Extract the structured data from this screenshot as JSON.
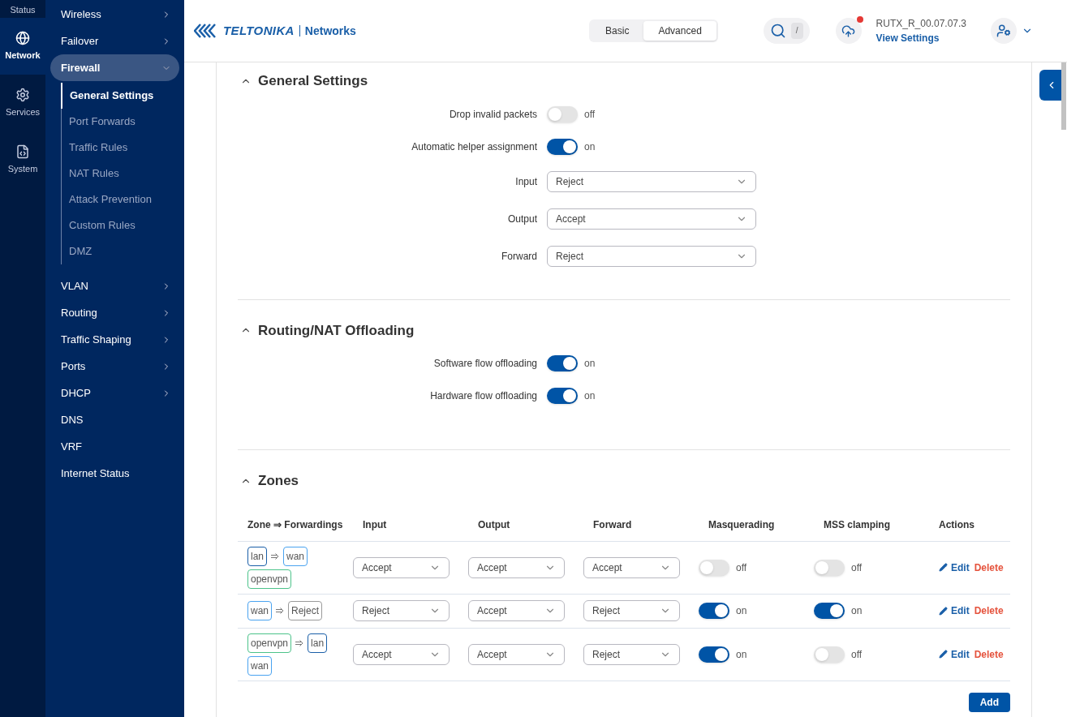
{
  "rail": [
    {
      "label": "Status",
      "selected": false
    },
    {
      "label": "Network",
      "selected": true
    },
    {
      "label": "Services",
      "selected": false
    },
    {
      "label": "System",
      "selected": false
    }
  ],
  "menu": [
    {
      "label": "Wireless",
      "arrow": true,
      "expanded": false
    },
    {
      "label": "Failover",
      "arrow": true,
      "expanded": false
    },
    {
      "label": "Firewall",
      "arrow": true,
      "expanded": true,
      "children": [
        {
          "label": "General Settings",
          "selected": true
        },
        {
          "label": "Port Forwards",
          "selected": false
        },
        {
          "label": "Traffic Rules",
          "selected": false
        },
        {
          "label": "NAT Rules",
          "selected": false
        },
        {
          "label": "Attack Prevention",
          "selected": false
        },
        {
          "label": "Custom Rules",
          "selected": false
        },
        {
          "label": "DMZ",
          "selected": false
        }
      ]
    },
    {
      "label": "VLAN",
      "arrow": true,
      "expanded": false
    },
    {
      "label": "Routing",
      "arrow": true,
      "expanded": false
    },
    {
      "label": "Traffic Shaping",
      "arrow": true,
      "expanded": false
    },
    {
      "label": "Ports",
      "arrow": true,
      "expanded": false
    },
    {
      "label": "DHCP",
      "arrow": true,
      "expanded": false
    },
    {
      "label": "DNS",
      "arrow": false,
      "expanded": false
    },
    {
      "label": "VRF",
      "arrow": false,
      "expanded": false
    },
    {
      "label": "Internet Status",
      "arrow": false,
      "expanded": false
    }
  ],
  "header": {
    "logo": "TELTONIKA",
    "logo_suffix": "Networks",
    "modes": [
      {
        "label": "Basic",
        "selected": false
      },
      {
        "label": "Advanced",
        "selected": true
      }
    ],
    "search_key": "/",
    "cloud_alert": true,
    "firmware": "RUTX_R_00.07.07.3",
    "view_settings": "View Settings"
  },
  "sections": [
    {
      "title": "General Settings",
      "expanded": true,
      "fields": [
        {
          "kind": "toggle",
          "label": "Drop invalid packets",
          "on": false,
          "state_text": "off"
        },
        {
          "kind": "toggle",
          "label": "Automatic helper assignment",
          "on": true,
          "state_text": "on"
        },
        {
          "kind": "select",
          "label": "Input",
          "value": "Reject"
        },
        {
          "kind": "select",
          "label": "Output",
          "value": "Accept"
        },
        {
          "kind": "select",
          "label": "Forward",
          "value": "Reject"
        }
      ]
    },
    {
      "title": "Routing/NAT Offloading",
      "expanded": true,
      "fields": [
        {
          "kind": "toggle",
          "label": "Software flow offloading",
          "on": true,
          "state_text": "on"
        },
        {
          "kind": "toggle",
          "label": "Hardware flow offloading",
          "on": true,
          "state_text": "on"
        }
      ]
    }
  ],
  "zones": {
    "title": "Zones",
    "expanded": true,
    "columns": [
      "Zone ⇒ Forwardings",
      "Input",
      "Output",
      "Forward",
      "Masquerading",
      "MSS clamping",
      "Actions"
    ],
    "rows": [
      {
        "zone": {
          "label": "lan",
          "color": "#1a5fa8"
        },
        "forwardings": [
          {
            "label": "wan",
            "color": "#4aa3f0"
          },
          {
            "label": "openvpn",
            "color": "#4cc38a"
          }
        ],
        "input": "Accept",
        "output": "Accept",
        "forward": "Accept",
        "masquerading": {
          "on": false,
          "text": "off"
        },
        "mss": {
          "on": false,
          "text": "off"
        },
        "edit": "Edit",
        "delete": "Delete"
      },
      {
        "zone": {
          "label": "wan",
          "color": "#4aa3f0"
        },
        "forwardings": [
          {
            "label": "Reject",
            "color": "#9a9a9a"
          }
        ],
        "input": "Reject",
        "output": "Accept",
        "forward": "Reject",
        "masquerading": {
          "on": true,
          "text": "on"
        },
        "mss": {
          "on": true,
          "text": "on"
        },
        "edit": "Edit",
        "delete": "Delete"
      },
      {
        "zone": {
          "label": "openvpn",
          "color": "#4cc38a"
        },
        "forwardings": [
          {
            "label": "lan",
            "color": "#1a5fa8"
          },
          {
            "label": "wan",
            "color": "#4aa3f0"
          }
        ],
        "input": "Accept",
        "output": "Accept",
        "forward": "Reject",
        "masquerading": {
          "on": true,
          "text": "on"
        },
        "mss": {
          "on": false,
          "text": "off"
        },
        "edit": "Edit",
        "delete": "Delete"
      }
    ],
    "add": "Add"
  }
}
